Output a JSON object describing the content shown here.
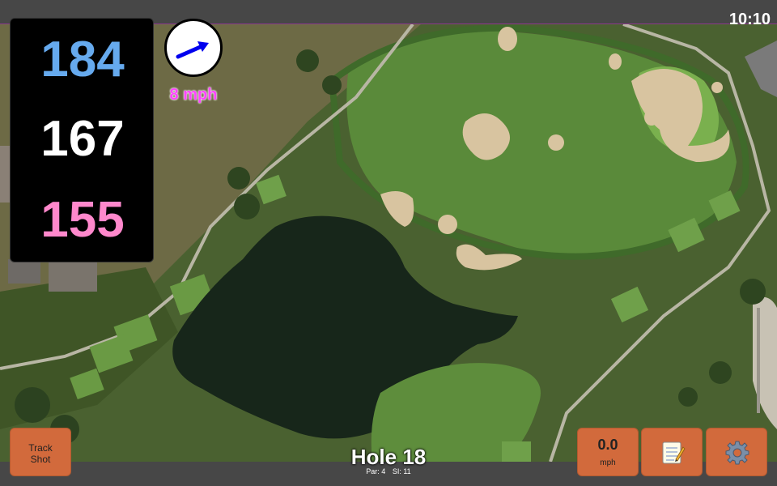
{
  "status_bar": {
    "time": "10:10"
  },
  "distances": {
    "back": "184",
    "middle": "167",
    "front": "155"
  },
  "wind": {
    "speed_label": "8 mph",
    "icon": "wind-arrow-icon"
  },
  "buttons": {
    "track_shot_line1": "Track",
    "track_shot_line2": "Shot",
    "swing_speed_value": "0.0",
    "swing_speed_unit": "mph",
    "notes_icon": "notepad-icon",
    "settings_icon": "gear-icon"
  },
  "hole": {
    "title": "Hole 18",
    "par_label": "Par: 4",
    "si_label": "SI: 11"
  },
  "colors": {
    "back_distance": "#66aaee",
    "middle_distance": "#ffffff",
    "front_distance": "#ff88cc",
    "wind_text": "#ff44ff",
    "button_fill": "#d26a3c"
  }
}
